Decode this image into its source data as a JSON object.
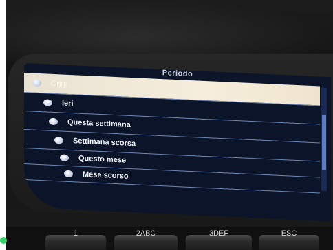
{
  "screen": {
    "title": "Periodo",
    "items": [
      {
        "label": "Oggi",
        "selected": true
      },
      {
        "label": "Ieri",
        "selected": false
      },
      {
        "label": "Questa settimana",
        "selected": false
      },
      {
        "label": "Settimana scorsa",
        "selected": false
      },
      {
        "label": "Questo mese",
        "selected": false
      },
      {
        "label": "Mese scorso",
        "selected": false
      }
    ]
  },
  "keypad": {
    "keys": [
      {
        "label": "1"
      },
      {
        "label": "2ABC"
      },
      {
        "label": "3DEF"
      },
      {
        "label": "ESC"
      }
    ]
  },
  "colors": {
    "screen_bg": "#0b1428",
    "selection": "#f0e8d6",
    "divider": "#6f86b8"
  }
}
